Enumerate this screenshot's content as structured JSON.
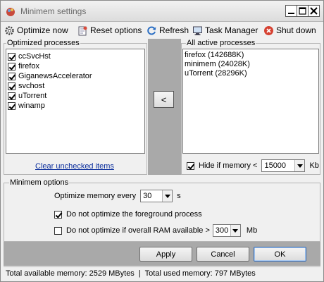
{
  "window": {
    "title": "Minimem settings"
  },
  "toolbar": {
    "optimize_now": "Optimize now",
    "reset_options": "Reset options",
    "refresh": "Refresh",
    "task_manager": "Task Manager",
    "shut_down": "Shut down"
  },
  "optimized": {
    "label": "Optimized processes",
    "items": [
      {
        "name": "ccSvcHst",
        "checked": true
      },
      {
        "name": "firefox",
        "checked": true
      },
      {
        "name": "GiganewsAccelerator",
        "checked": true
      },
      {
        "name": "svchost",
        "checked": true
      },
      {
        "name": "uTorrent",
        "checked": true
      },
      {
        "name": "winamp",
        "checked": true
      }
    ],
    "clear_link": "Clear unchecked items"
  },
  "move_button": "<",
  "active": {
    "label": "All active processes",
    "items": [
      "firefox (142688K)",
      "minimem (24028K)",
      "uTorrent (28296K)"
    ],
    "hide_label": "Hide if memory <",
    "hide_checked": true,
    "hide_value": "15000",
    "hide_unit": "Kb"
  },
  "options": {
    "label": "Minimem options",
    "every_label": "Optimize memory every",
    "every_value": "30",
    "every_unit": "s",
    "foreground_label": "Do not optimize the foreground process",
    "foreground_checked": true,
    "ram_label": "Do not optimize if overall RAM available >",
    "ram_checked": false,
    "ram_value": "300",
    "ram_unit": "Mb"
  },
  "buttons": {
    "apply": "Apply",
    "cancel": "Cancel",
    "ok": "OK"
  },
  "status": {
    "available": "Total available memory: 2529 MBytes",
    "separator": "|",
    "used": "Total used memory: 797 MBytes"
  }
}
